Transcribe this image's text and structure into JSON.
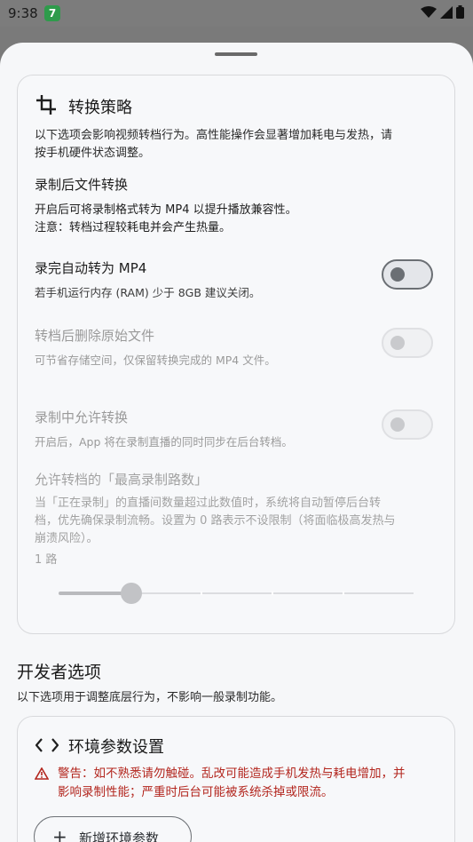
{
  "status_bar": {
    "time": "9:38",
    "badge": "7",
    "icons": [
      "wifi-icon",
      "signal-icon",
      "battery-icon"
    ]
  },
  "strategy_card": {
    "title": "转换策略",
    "icon": "crop-icon",
    "description_line1": "以下选项会影响视频转档行为。高性能操作会显著增加耗电与发热，请",
    "description_line2": "按手机硬件状态调整。",
    "post_record_heading": "录制后文件转换",
    "post_record_note_line1": "开启后可将录制格式转为 MP4 以提升播放兼容性。",
    "post_record_note_line2": "注意：转档过程较耗电并会产生热量。",
    "options": [
      {
        "title": "录完自动转为 MP4",
        "subtitle": "若手机运行内存 (RAM) 少于 8GB 建议关闭。",
        "checked": false,
        "enabled": true
      },
      {
        "title": "转档后删除原始文件",
        "subtitle": "可节省存储空间，仅保留转换完成的 MP4 文件。",
        "checked": false,
        "enabled": false
      },
      {
        "title": "录制中允许转换",
        "subtitle": "开启后，App 将在录制直播的同时同步在后台转档。",
        "checked": false,
        "enabled": false
      }
    ],
    "max_limit_heading": "允许转档的「最高录制路数」",
    "max_limit_desc_line1": "当「正在录制」的直播间数量超过此数值时，系统将自动暂停后台转",
    "max_limit_desc_line2": "档，优先确保录制流畅。设置为 0 路表示不设限制（将面临极高发热与",
    "max_limit_desc_line3": "崩溃风险）。",
    "slider_value_label": "1 路",
    "slider": {
      "min": 0,
      "max": 5,
      "value": 1
    }
  },
  "developer_section": {
    "title": "开发者选项",
    "description": "以下选项用于调整底层行为，不影响一般录制功能。"
  },
  "env_card": {
    "title": "环境参数设置",
    "icon": "code-icon",
    "warning_line1": "警告：如不熟悉请勿触碰。乱改可能造成手机发热与耗电增加，并",
    "warning_line2": "影响录制性能；严重时后台可能被系统杀掉或限流。",
    "add_button_label": "新增环境参数"
  },
  "colors": {
    "warning": "#b3261e",
    "badge": "#2e9b4b"
  }
}
